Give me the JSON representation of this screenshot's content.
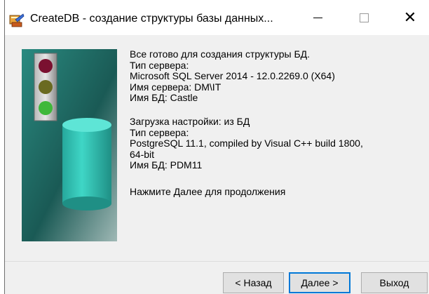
{
  "window": {
    "title": "CreateDB - создание структуры базы данных...",
    "controls": {
      "minimize": "—",
      "maximize": "☐",
      "close": "✕"
    }
  },
  "info": {
    "source": {
      "ready": "Все готово для создания структуры БД.",
      "server_type_label": "Тип сервера:",
      "server_type": "Microsoft SQL Server 2014 - 12.0.2269.0 (X64)",
      "server_name": "Имя сервера: DM\\IT",
      "db_name": "Имя БД: Castle"
    },
    "settings": {
      "load_settings": "Загрузка настройки: из БД",
      "server_type_label": "Тип сервера:",
      "server_type_line1": "PostgreSQL 11.1, compiled by Visual C++ build 1800,",
      "server_type_line2": "64-bit",
      "db_name": "Имя БД: PDM11"
    },
    "hint": "Нажмите Далее для продолжения"
  },
  "buttons": {
    "back": "< Назад",
    "next": "Далее >",
    "exit": "Выход"
  },
  "colors": {
    "accent": "#0078d7",
    "picture_bg": "#1f6f68",
    "cylinder": "#2ec4b6"
  },
  "icons": {
    "app": "database-wizard-icon",
    "illustration": "traffic-light-and-database-cylinder"
  }
}
